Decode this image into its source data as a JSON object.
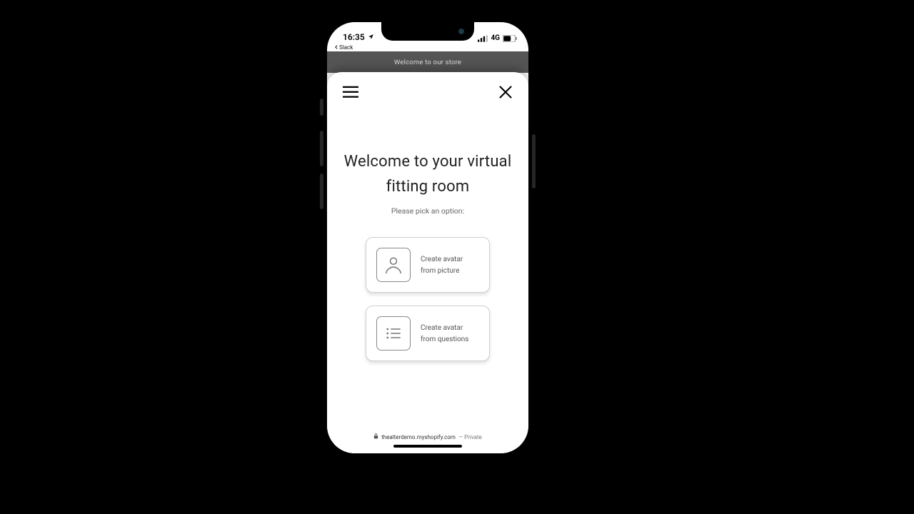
{
  "status": {
    "time": "16:35",
    "network_label": "4G",
    "return_app": "Slack"
  },
  "banner": {
    "text": "Welcome to our store"
  },
  "sheet": {
    "title": "Welcome to your virtual fitting room",
    "subtitle": "Please pick an option:"
  },
  "options": {
    "picture": {
      "line1": "Create avatar",
      "line2": "from picture"
    },
    "questions": {
      "line1": "Create avatar",
      "line2": "from questions"
    }
  },
  "browser": {
    "domain": "thealterdemo.myshopify.com",
    "private_label": "— Private"
  }
}
